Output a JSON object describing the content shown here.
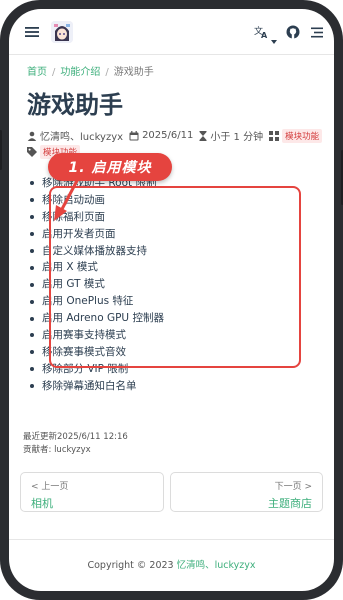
{
  "navbar": {
    "menu_icon": "hamburger-icon",
    "logo_icon": "anime-avatar-logo",
    "translate_icon": "translate-icon",
    "github_icon": "github-icon",
    "outline_icon": "outline-icon"
  },
  "breadcrumb": [
    "首页",
    "功能介绍",
    "游戏助手"
  ],
  "page": {
    "title": "游戏助手",
    "authors": "忆清鸣、luckyzyx",
    "date": "2025/6/11",
    "reading_time": "小于 1 分钟",
    "category": "模块功能",
    "tag": "模块功能"
  },
  "annotation": {
    "label": "1. 启用模块",
    "color": "#e5443f"
  },
  "features": [
    "移除游戏助手 Root 限制",
    "移除启动动画",
    "移除福利页面",
    "启用开发者页面",
    "自定义媒体播放器支持",
    "启用 X 模式",
    "启用 GT 模式",
    "启用 OnePlus 特征",
    "启用 Adreno GPU 控制器",
    "启用赛事支持模式",
    "移除赛事模式音效",
    "移除部分 VIP 限制",
    "移除弹幕通知白名单"
  ],
  "meta_footer": {
    "updated": "最近更新2025/6/11 12:16",
    "contributors": "贡献者: luckyzyx"
  },
  "pager": {
    "prev_hint": "< 上一页",
    "prev_name": "相机",
    "next_hint": "下一页 >",
    "next_name": "主题商店"
  },
  "footer": {
    "copyright": "Copyright © 2023 ",
    "authors": "忆清鸣、luckyzyx"
  },
  "colors": {
    "accent": "#3eaf7c",
    "badge_text": "#d33c3c",
    "badge_bg": "#fde8e8"
  }
}
